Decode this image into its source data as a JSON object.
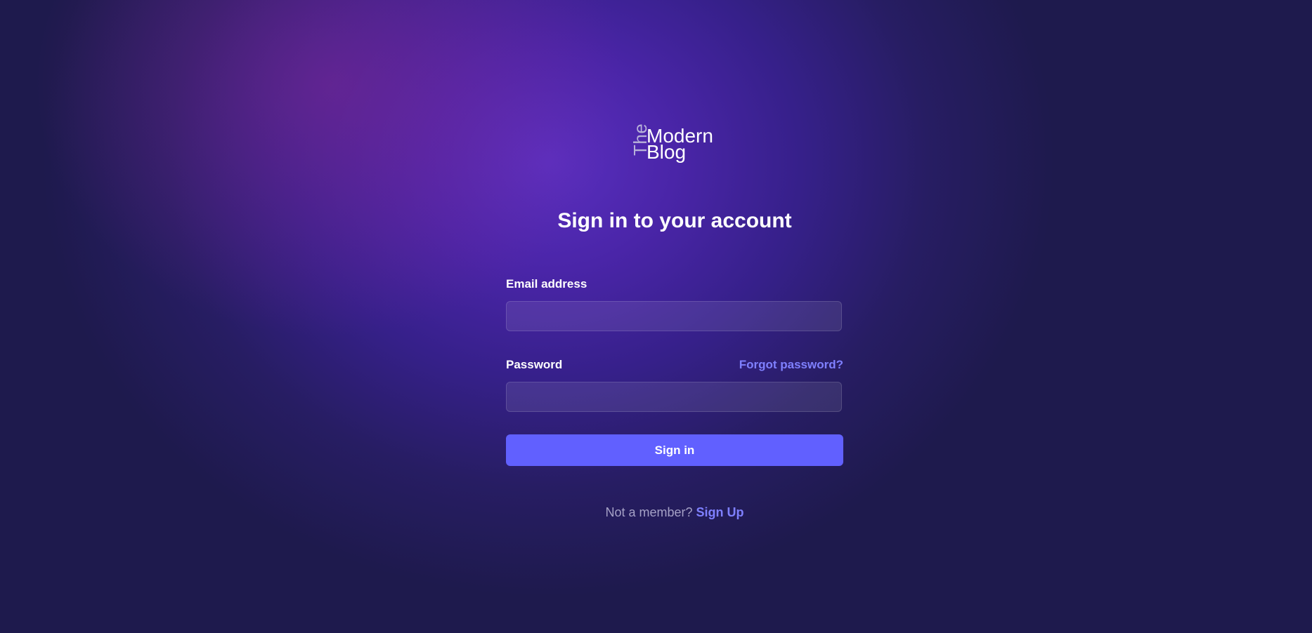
{
  "logo": {
    "the": "The",
    "modern": "Modern",
    "blog": "Blog"
  },
  "title": "Sign in to your account",
  "form": {
    "email_label": "Email address",
    "email_value": "",
    "password_label": "Password",
    "password_value": "",
    "forgot_label": "Forgot password?",
    "submit_label": "Sign in"
  },
  "footer": {
    "prompt": "Not a member?",
    "signup_label": "Sign Up"
  },
  "colors": {
    "accent": "#6160ff",
    "link": "#7f80ff",
    "background": "#1e1a4d"
  }
}
